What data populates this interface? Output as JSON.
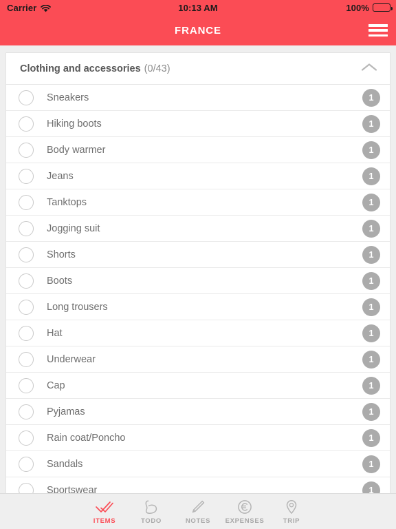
{
  "colors": {
    "accent": "#FB4C55",
    "nav_text": "#FFFFFF",
    "page_bg": "#EFEFEF",
    "card_bg": "#FFFFFF",
    "badge_bg": "#ABABAB",
    "row_text": "#6E6E6E",
    "header_text": "#585858",
    "tab_inactive": "#A8A8A8"
  },
  "status_bar": {
    "carrier": "Carrier",
    "wifi_icon": "wifi-icon",
    "time": "10:13 AM",
    "battery_percent": "100%",
    "battery_icon": "battery-full-icon"
  },
  "nav_bar": {
    "title": "FRANCE",
    "menu_icon": "hamburger-menu-icon"
  },
  "section": {
    "title": "Clothing and accessories",
    "count": "(0/43)",
    "collapse_icon": "chevron-up-icon",
    "expanded": true
  },
  "items": [
    {
      "label": "Sneakers",
      "qty": "1",
      "checked": false
    },
    {
      "label": "Hiking boots",
      "qty": "1",
      "checked": false
    },
    {
      "label": "Body warmer",
      "qty": "1",
      "checked": false
    },
    {
      "label": "Jeans",
      "qty": "1",
      "checked": false
    },
    {
      "label": "Tanktops",
      "qty": "1",
      "checked": false
    },
    {
      "label": "Jogging suit",
      "qty": "1",
      "checked": false
    },
    {
      "label": "Shorts",
      "qty": "1",
      "checked": false
    },
    {
      "label": "Boots",
      "qty": "1",
      "checked": false
    },
    {
      "label": "Long trousers",
      "qty": "1",
      "checked": false
    },
    {
      "label": "Hat",
      "qty": "1",
      "checked": false
    },
    {
      "label": "Underwear",
      "qty": "1",
      "checked": false
    },
    {
      "label": "Cap",
      "qty": "1",
      "checked": false
    },
    {
      "label": "Pyjamas",
      "qty": "1",
      "checked": false
    },
    {
      "label": "Rain coat/Poncho",
      "qty": "1",
      "checked": false
    },
    {
      "label": "Sandals",
      "qty": "1",
      "checked": false
    },
    {
      "label": "Sportswear",
      "qty": "1",
      "checked": false
    }
  ],
  "tabs": [
    {
      "label": "ITEMS",
      "icon": "double-check-icon",
      "active": true
    },
    {
      "label": "TODO",
      "icon": "flexed-bicep-icon",
      "active": false
    },
    {
      "label": "NOTES",
      "icon": "pencil-icon",
      "active": false
    },
    {
      "label": "EXPENSES",
      "icon": "euro-circle-icon",
      "active": false
    },
    {
      "label": "TRIP",
      "icon": "map-pin-icon",
      "active": false
    }
  ]
}
